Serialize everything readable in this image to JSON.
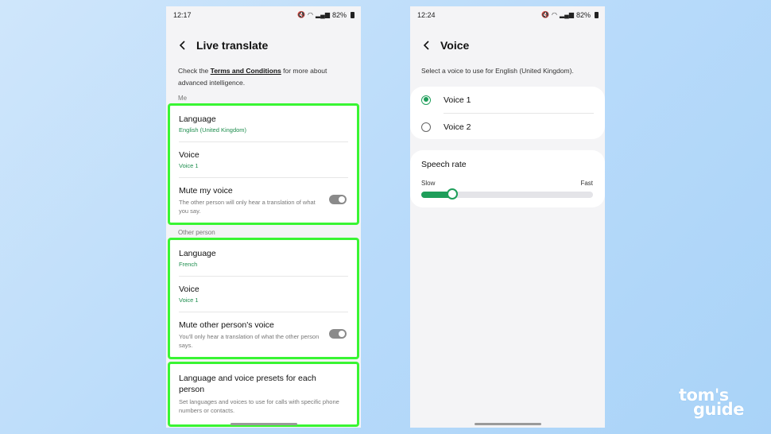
{
  "left_phone": {
    "status": {
      "time": "12:17",
      "battery": "82%"
    },
    "title": "Live translate",
    "intro": {
      "prefix": "Check the ",
      "link": "Terms and Conditions",
      "suffix": " for more about advanced intelligence."
    },
    "me_label": "Me",
    "me": {
      "language_title": "Language",
      "language_value": "English (United Kingdom)",
      "voice_title": "Voice",
      "voice_value": "Voice 1",
      "mute_title": "Mute my voice",
      "mute_desc": "The other person will only hear a translation of what you say."
    },
    "other_label": "Other person",
    "other": {
      "language_title": "Language",
      "language_value": "French",
      "voice_title": "Voice",
      "voice_value": "Voice 1",
      "mute_title": "Mute other person's voice",
      "mute_desc": "You'll only hear a translation of what the other person says."
    },
    "presets": {
      "title": "Language and voice presets for each person",
      "desc": "Set languages and voices to use for calls with specific phone numbers or contacts."
    }
  },
  "right_phone": {
    "status": {
      "time": "12:24",
      "battery": "82%"
    },
    "title": "Voice",
    "intro": "Select a voice to use for English (United Kingdom).",
    "voices": [
      {
        "label": "Voice 1",
        "selected": true
      },
      {
        "label": "Voice 2",
        "selected": false
      }
    ],
    "speech_rate": {
      "title": "Speech rate",
      "min_label": "Slow",
      "max_label": "Fast",
      "value": 0.18
    }
  },
  "logo": {
    "line1": "tom's",
    "line2": "guide"
  },
  "colors": {
    "accent": "#1e9e5a",
    "highlight": "#39f533"
  }
}
